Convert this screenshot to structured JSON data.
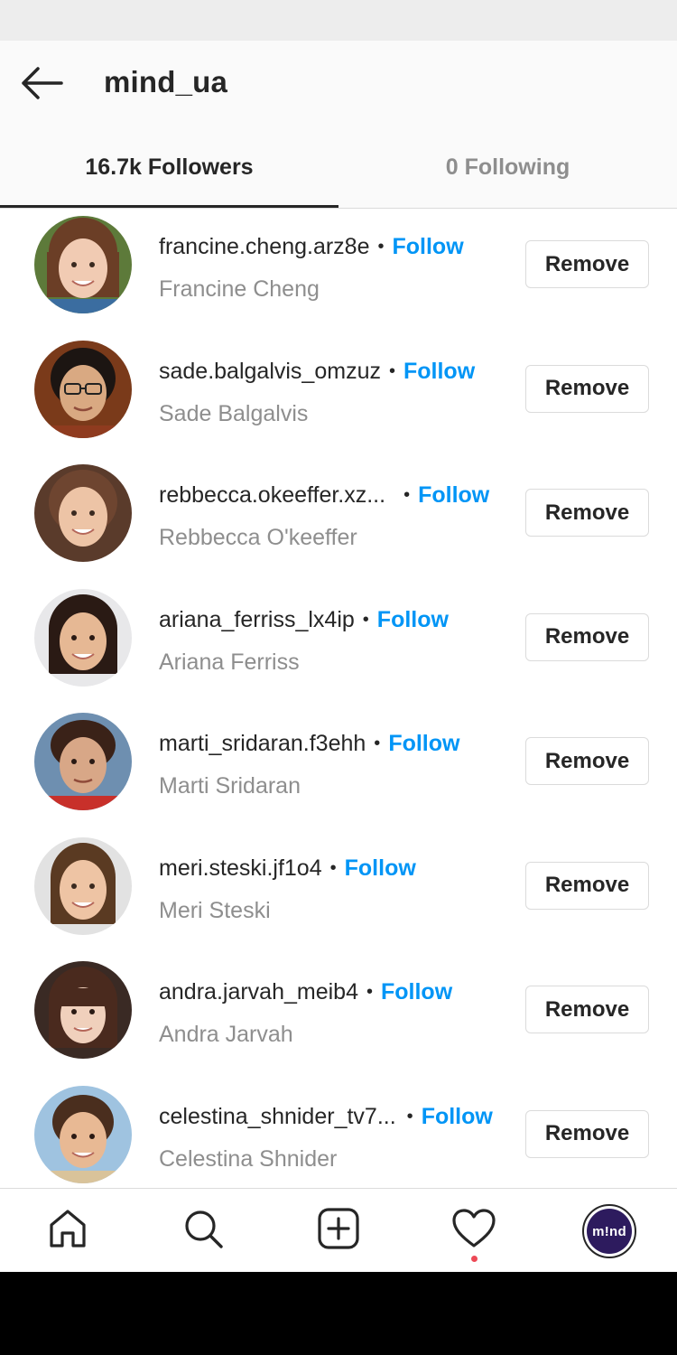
{
  "header": {
    "back_icon": "arrow-left-icon",
    "title": "mind_ua"
  },
  "tabs": [
    {
      "label": "16.7k Followers",
      "active": true
    },
    {
      "label": "0 Following",
      "active": false
    }
  ],
  "followers": [
    {
      "username": "francine.cheng.arz8e",
      "separator": "•",
      "action": "Follow",
      "full_name": "Francine Cheng",
      "button": "Remove"
    },
    {
      "username": "sade.balgalvis_omzuz",
      "separator": "•",
      "action": "Follow",
      "full_name": "Sade Balgalvis",
      "button": "Remove"
    },
    {
      "username": "rebbecca.okeeffer.xz...",
      "separator": "•",
      "action": "Follow",
      "full_name": "Rebbecca O'keeffer",
      "button": "Remove"
    },
    {
      "username": "ariana_ferriss_lx4ip",
      "separator": "•",
      "action": "Follow",
      "full_name": "Ariana Ferriss",
      "button": "Remove"
    },
    {
      "username": "marti_sridaran.f3ehh",
      "separator": "•",
      "action": "Follow",
      "full_name": "Marti Sridaran",
      "button": "Remove"
    },
    {
      "username": "meri.steski.jf1o4",
      "separator": "•",
      "action": "Follow",
      "full_name": "Meri Steski",
      "button": "Remove"
    },
    {
      "username": "andra.jarvah_meib4",
      "separator": "•",
      "action": "Follow",
      "full_name": "Andra Jarvah",
      "button": "Remove"
    },
    {
      "username": "celestina_shnider_tv7...",
      "separator": "•",
      "action": "Follow",
      "full_name": "Celestina Shnider",
      "button": "Remove"
    }
  ],
  "bottom_nav": {
    "items": [
      "home-icon",
      "search-icon",
      "new-post-icon",
      "activity-heart-icon",
      "profile-avatar"
    ],
    "profile_logo_text": "m!nd",
    "activity_has_notification": true
  },
  "colors": {
    "accent_blue": "#0095f6",
    "text_primary": "#262626",
    "text_secondary": "#8e8e8e",
    "notification_red": "#ed4956",
    "profile_bg": "#2d1b5e"
  }
}
